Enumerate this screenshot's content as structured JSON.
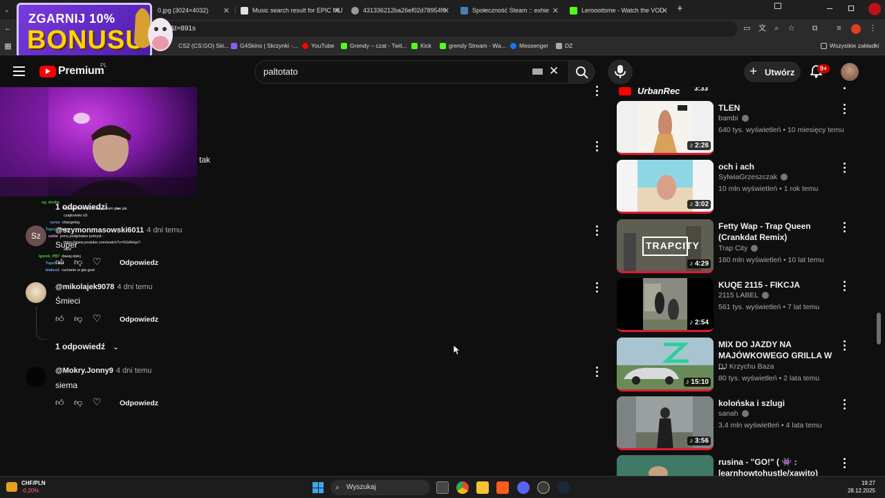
{
  "browser": {
    "tabs": [
      {
        "title": "0.jpg (3024×4032)",
        "color": "#777777"
      },
      {
        "title": "Music search result for EPIC MU",
        "color": "#e0e0e0"
      },
      {
        "title": "431336212ba26ef02d78954f6",
        "color": "#9a9a9a"
      },
      {
        "title": "Społeczność Steam :: exhie",
        "color": "#4a7cb5"
      },
      {
        "title": "Leroooitsme - Watch the VOD",
        "color": "#53fc18"
      }
    ],
    "address": "&t=891s",
    "bookmarks": [
      {
        "label": "CS2 (CS:GO) Ski...",
        "color": "#888888"
      },
      {
        "label": "G4Skins | Skrzynki -...",
        "color": "#8a5cf5"
      },
      {
        "label": "YouTube",
        "color": "#ff0000"
      },
      {
        "label": "Grendy – czat - Twit...",
        "color": "#53fc18"
      },
      {
        "label": "Kick",
        "color": "#53fc18"
      },
      {
        "label": "grendy Stream - Wa...",
        "color": "#53fc18"
      },
      {
        "label": "Messenger",
        "color": "#1877f2"
      },
      {
        "label": "DZ",
        "color": "#aaaaaa"
      }
    ],
    "all_bookmarks": "Wszystkie zakładki"
  },
  "promo": {
    "line1": "ZGARNIJ 10%",
    "line2": "BONUSU"
  },
  "yt": {
    "logo": "Premium",
    "region": "PL",
    "search_value": "paltotato",
    "create_label": "Utwórz",
    "notif_count": "9+"
  },
  "overlay_text": "tak",
  "chat": [
    {
      "user": "og_donks",
      "msg": ""
    },
    {
      "user": "",
      "msg": "tam ale kolo sproż ze ja mam glos jak"
    },
    {
      "user": "",
      "msg": "czajkowski xD"
    },
    {
      "user": "cyrus",
      "msg": "changelog"
    },
    {
      "user": "Topci",
      "msg": "czapla"
    },
    {
      "user": "exhie",
      "msg": "jemu podjebałes pomysł -"
    },
    {
      "user": "",
      "msg": "https://www.youtube.com/watch?v=SGAHqs7-"
    },
    {
      "user": "",
      "msg": "xBM"
    },
    {
      "user": "Igorek_PB7",
      "msg": "dawaj dalej"
    },
    {
      "user": "Topci",
      "msg": "add"
    },
    {
      "user": "klakus1",
      "msg": "ruchanie w gta gost"
    }
  ],
  "comments": [
    {
      "replies_label": "1 odpowiedzi"
    },
    {
      "avatar_initials": "Sz",
      "handle": "@szymonmasowski6011",
      "when": "4 dni temu",
      "text": "Super",
      "reply": "Odpowiedz"
    },
    {
      "handle": "@mikolajek9078",
      "when": "4 dni temu",
      "text": "Śmieci",
      "reply": "Odpowiedz",
      "replies_label": "1 odpowiedź"
    },
    {
      "handle": "@Mokry.Jonny9",
      "when": "4 dni temu",
      "text": "siema",
      "reply": "Odpowiedz"
    }
  ],
  "top_related_channel": "UrbanRec",
  "top_related_duration": "3:33",
  "related": [
    {
      "title": "TLEN",
      "channel": "bambi",
      "verified": true,
      "meta": "640 tys. wyświetleń • 10 miesięcy temu",
      "duration": "2:26",
      "thumb_color": "#f0f0f0"
    },
    {
      "title": "och i ach",
      "channel": "SylwiaGrzeszczak",
      "verified": true,
      "meta": "10 mln wyświetleń • 1 rok temu",
      "duration": "3:02",
      "thumb_color": "#79c9d8"
    },
    {
      "title": "Fetty Wap - Trap Queen (Crankdat Remix)",
      "channel": "Trap City",
      "verified": true,
      "meta": "160 mln wyświetleń • 10 lat temu",
      "duration": "4:29",
      "thumb_color": "#6b6b5e",
      "thumb_text": "TRAPCITY"
    },
    {
      "title": "KUQE 2115 - FIKCJA",
      "channel": "2115 LABEL",
      "verified": true,
      "meta": "561 tys. wyświetleń • 7 lat temu",
      "duration": "2:54",
      "thumb_color": "#8a8a8a"
    },
    {
      "title": "MIX DO JAZDY NA MAJÓWKOWEGO GRILLA W ...",
      "channel": "DJ Krzychu Baza",
      "verified": false,
      "meta": "80 tys. wyświetleń • 2 lata temu",
      "duration": "15:10",
      "thumb_color": "#9fb9a0"
    },
    {
      "title": "kolońska i szlugi",
      "channel": "sanah",
      "verified": true,
      "meta": "3,4 mln wyświetleń • 4 lata temu",
      "duration": "3:56",
      "thumb_color": "#7d8382"
    },
    {
      "title": "rusina - \"GO!\" ( 👾 : learnhowtohustle/xawito)",
      "channel": "",
      "verified": false,
      "meta": "",
      "duration": "",
      "thumb_color": "#3a6b5c"
    }
  ],
  "taskbar": {
    "ticker": "CHF/PLN",
    "ticker_change": "-0,20%",
    "search_label": "Wyszukaj",
    "time": "19:27",
    "date": "28.12.2025"
  }
}
